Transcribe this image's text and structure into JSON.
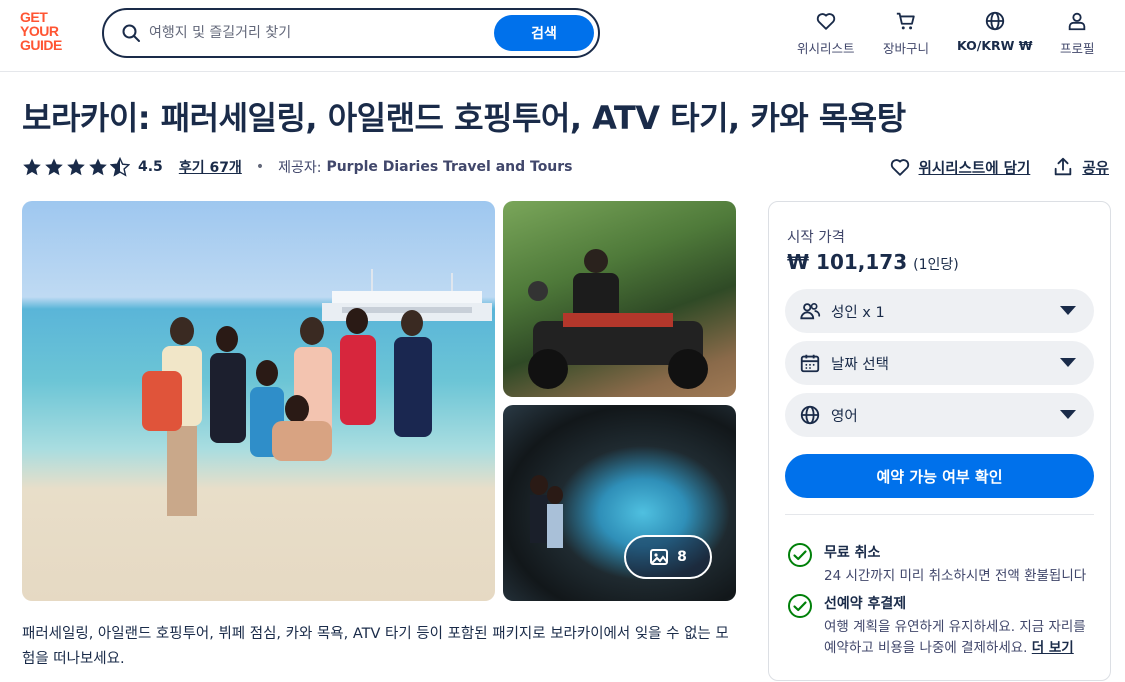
{
  "header": {
    "logo": [
      "GET",
      "YOUR",
      "GUIDE"
    ],
    "search": {
      "placeholder": "여행지 및 즐길거리 찾기",
      "button": "검색"
    },
    "nav": {
      "wishlist": "위시리스트",
      "cart": "장바구니",
      "locale": "KO/KRW ₩",
      "profile": "프로필"
    }
  },
  "activity": {
    "title": "보라카이: 패러세일링, 아일랜드 호핑투어, ATV 타기, 카와 목욕탕",
    "rating": "4.5",
    "rating_value": 4.5,
    "reviews": "후기 67개",
    "provider_label": "제공자:",
    "provider": "Purple Diaries Travel and Tours",
    "save": "위시리스트에 담기",
    "share": "공유",
    "photo_count": "8",
    "description": "패러세일링, 아일랜드 호핑투어, 뷔페 점심, 카와 목욕, ATV 타기 등이 포함된 패키지로 보라카이에서 잊을 수 없는 모험을 떠나보세요."
  },
  "booking": {
    "from_label": "시작 가격",
    "price": "₩ 101,173",
    "per_person": "(1인당)",
    "participants": "성인 x 1",
    "date": "날짜 선택",
    "language": "영어",
    "check_button": "예약 가능 여부 확인",
    "features": [
      {
        "title": "무료 취소",
        "desc": "24 시간까지 미리 취소하시면 전액 환불됩니다"
      },
      {
        "title": "선예약 후결제",
        "desc": "여행 계획을 유연하게 유지하세요. 지금 자리를 예약하고 비용을 나중에 결제하세요.",
        "more": "더 보기"
      }
    ],
    "accent_color": "#0071eb",
    "check_color": "#008009"
  }
}
